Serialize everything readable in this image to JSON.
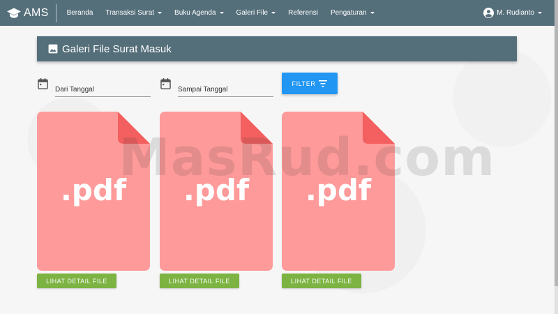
{
  "navbar": {
    "brand": "AMS",
    "items": [
      {
        "label": "Beranda",
        "dropdown": false
      },
      {
        "label": "Transaksi Surat",
        "dropdown": true
      },
      {
        "label": "Buku Agenda",
        "dropdown": true
      },
      {
        "label": "Galeri File",
        "dropdown": true
      },
      {
        "label": "Referensi",
        "dropdown": false
      },
      {
        "label": "Pengaturan",
        "dropdown": true
      }
    ],
    "user": "M. Rudianto"
  },
  "page": {
    "title": "Galeri File Surat Masuk"
  },
  "filter": {
    "from_placeholder": "Dari Tanggal",
    "to_placeholder": "Sampai Tanggal",
    "button_label": "FILTER"
  },
  "files": [
    {
      "ext": ".pdf",
      "button": "LIHAT DETAIL FILE"
    },
    {
      "ext": ".pdf",
      "button": "LIHAT DETAIL FILE"
    },
    {
      "ext": ".pdf",
      "button": "LIHAT DETAIL FILE"
    }
  ],
  "watermark": "MasRud.com",
  "colors": {
    "navbar": "#546e7a",
    "filter_button": "#2196f3",
    "detail_button": "#7cb342",
    "pdf_body": "#ff9a9a",
    "pdf_fold": "#f45f5f"
  }
}
